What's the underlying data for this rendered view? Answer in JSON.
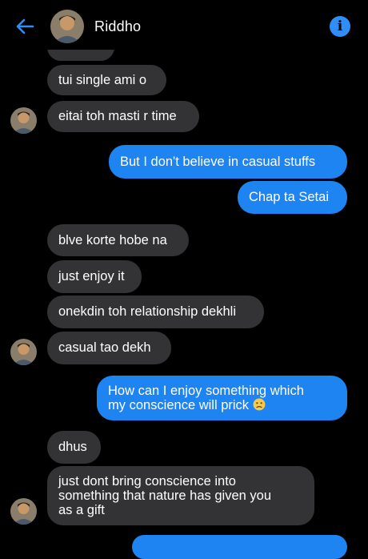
{
  "header": {
    "contact_name": "Riddho",
    "back_icon": "arrow-left-icon",
    "info_icon": "info-icon",
    "info_glyph": "i",
    "accent": "#2f8ef5"
  },
  "messages": [
    {
      "dir": "in",
      "text": "tui single ami o"
    },
    {
      "dir": "in",
      "text": "eitai toh masti r time"
    },
    {
      "dir": "out",
      "text": "But I don't believe in casual stuffs"
    },
    {
      "dir": "out",
      "text": "Chap ta Setai"
    },
    {
      "dir": "in",
      "text": "blve korte hobe na"
    },
    {
      "dir": "in",
      "text": "just enjoy it"
    },
    {
      "dir": "in",
      "text": "onekdin toh relationship dekhli"
    },
    {
      "dir": "in",
      "text": "casual tao dekh"
    },
    {
      "dir": "out",
      "line1": "How can I enjoy something which",
      "line2": "my conscience will prick",
      "emoji": "frowning-face-emoji"
    },
    {
      "dir": "in",
      "text": "dhus"
    },
    {
      "dir": "in",
      "line1": "just dont bring conscience into",
      "line2": "something that nature has given you",
      "line3": "as a gift"
    }
  ],
  "colors": {
    "incoming_bubble": "#333336",
    "outgoing_bubble": "#1d84f2",
    "background": "#000000"
  }
}
